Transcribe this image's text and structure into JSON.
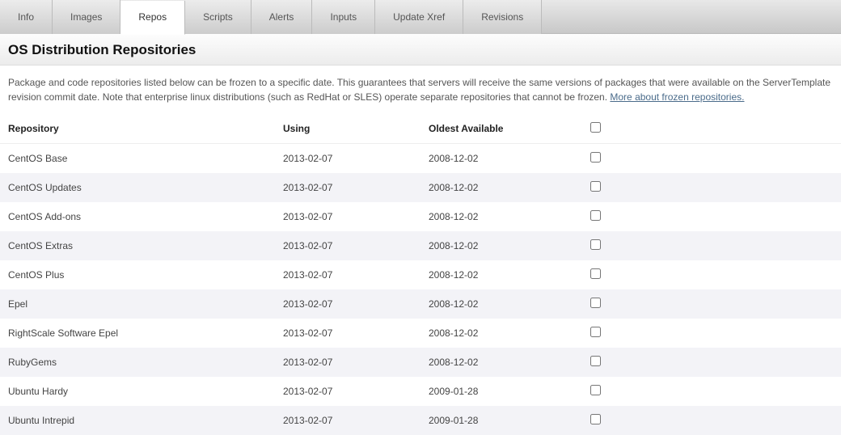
{
  "tabs": [
    {
      "label": "Info",
      "active": false
    },
    {
      "label": "Images",
      "active": false
    },
    {
      "label": "Repos",
      "active": true
    },
    {
      "label": "Scripts",
      "active": false
    },
    {
      "label": "Alerts",
      "active": false
    },
    {
      "label": "Inputs",
      "active": false
    },
    {
      "label": "Update Xref",
      "active": false
    },
    {
      "label": "Revisions",
      "active": false
    }
  ],
  "section_title": "OS Distribution Repositories",
  "description_text": "Package and code repositories listed below can be frozen to a specific date. This guarantees that servers will receive the same versions of packages that were available on the ServerTemplate revision commit date. Note that enterprise linux distributions (such as RedHat or SLES) operate separate repositories that cannot be frozen. ",
  "description_link": "More about frozen repositories.",
  "table": {
    "headers": {
      "repository": "Repository",
      "using": "Using",
      "oldest": "Oldest Available"
    },
    "rows": [
      {
        "name": "CentOS Base",
        "using": "2013-02-07",
        "oldest": "2008-12-02"
      },
      {
        "name": "CentOS Updates",
        "using": "2013-02-07",
        "oldest": "2008-12-02"
      },
      {
        "name": "CentOS Add-ons",
        "using": "2013-02-07",
        "oldest": "2008-12-02"
      },
      {
        "name": "CentOS Extras",
        "using": "2013-02-07",
        "oldest": "2008-12-02"
      },
      {
        "name": "CentOS Plus",
        "using": "2013-02-07",
        "oldest": "2008-12-02"
      },
      {
        "name": "Epel",
        "using": "2013-02-07",
        "oldest": "2008-12-02"
      },
      {
        "name": "RightScale Software Epel",
        "using": "2013-02-07",
        "oldest": "2008-12-02"
      },
      {
        "name": "RubyGems",
        "using": "2013-02-07",
        "oldest": "2008-12-02"
      },
      {
        "name": "Ubuntu Hardy",
        "using": "2013-02-07",
        "oldest": "2009-01-28"
      },
      {
        "name": "Ubuntu Intrepid",
        "using": "2013-02-07",
        "oldest": "2009-01-28"
      }
    ]
  }
}
